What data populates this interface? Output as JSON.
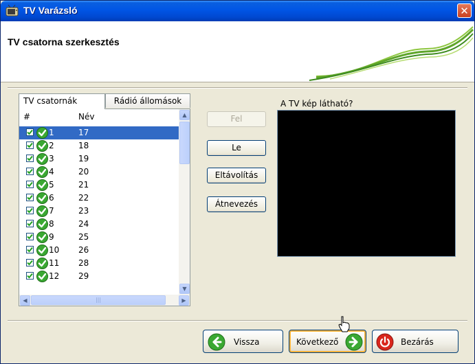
{
  "window": {
    "title": "TV Varázsló",
    "close_glyph": "✕"
  },
  "header": {
    "title": "TV csatorna szerkesztés"
  },
  "tabs": [
    "TV csatornák",
    "Rádió állomások"
  ],
  "list": {
    "columns": {
      "hash": "#",
      "name": "Név"
    },
    "rows": [
      {
        "num": "1",
        "name": "17",
        "checked": true,
        "selected": true
      },
      {
        "num": "2",
        "name": "18",
        "checked": true
      },
      {
        "num": "3",
        "name": "19",
        "checked": true
      },
      {
        "num": "4",
        "name": "20",
        "checked": true
      },
      {
        "num": "5",
        "name": "21",
        "checked": true
      },
      {
        "num": "6",
        "name": "22",
        "checked": true
      },
      {
        "num": "7",
        "name": "23",
        "checked": true
      },
      {
        "num": "8",
        "name": "24",
        "checked": true
      },
      {
        "num": "9",
        "name": "25",
        "checked": true
      },
      {
        "num": "10",
        "name": "26",
        "checked": true
      },
      {
        "num": "11",
        "name": "28",
        "checked": true
      },
      {
        "num": "12",
        "name": "29",
        "checked": true
      }
    ]
  },
  "actions": {
    "up": "Fel",
    "down": "Le",
    "remove": "Eltávolítás",
    "rename": "Átnevezés"
  },
  "preview": {
    "label": "A TV kép látható?"
  },
  "footer": {
    "back": "Vissza",
    "next": "Következő",
    "close": "Bezárás"
  },
  "icons": {
    "app": "tv-icon",
    "row_status": "green-check-icon",
    "back": "green-left-arrow-icon",
    "next": "green-right-arrow-icon",
    "close": "red-power-icon"
  },
  "colors": {
    "selection": "#316ac5",
    "titlebar": "#0055e5",
    "ok_green": "#3aa832",
    "close_red": "#d9261c"
  }
}
